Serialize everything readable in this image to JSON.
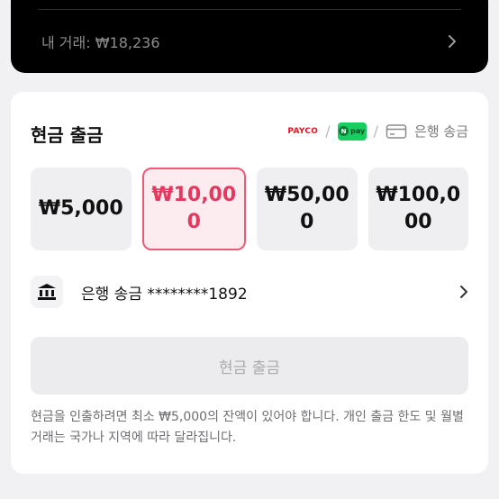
{
  "top_card": {
    "trade_label": "내 거래: ₩18,236"
  },
  "withdraw": {
    "title": "현금 출금",
    "methods": {
      "payco": "PAYCO",
      "separator": "/",
      "npay_mark": "N",
      "npay_text": "pay",
      "bank_transfer": "은행 송금"
    },
    "amounts": [
      {
        "label": "₩5,000",
        "selected": false
      },
      {
        "label": "₩10,000",
        "selected": true
      },
      {
        "label": "₩50,000",
        "selected": false
      },
      {
        "label": "₩100,000",
        "selected": false
      }
    ],
    "bank_account": "은행 송금 ********1892",
    "button_label": "현금 출금",
    "notice": "현금을 인출하려면 최소 ₩5,000의 잔액이 있어야 합니다. 개인 출금 한도 및 월별 거래는 국가나 지역에 따라 달라집니다."
  },
  "colors": {
    "accent": "#e3385f",
    "selected_bg": "#fdecef",
    "payco": "#e6141e",
    "npay": "#19ce60"
  },
  "icons": {
    "top_chevron": "chevron-right-icon",
    "bank": "bank-icon",
    "card": "card-icon",
    "bank_chevron": "chevron-right-icon"
  }
}
